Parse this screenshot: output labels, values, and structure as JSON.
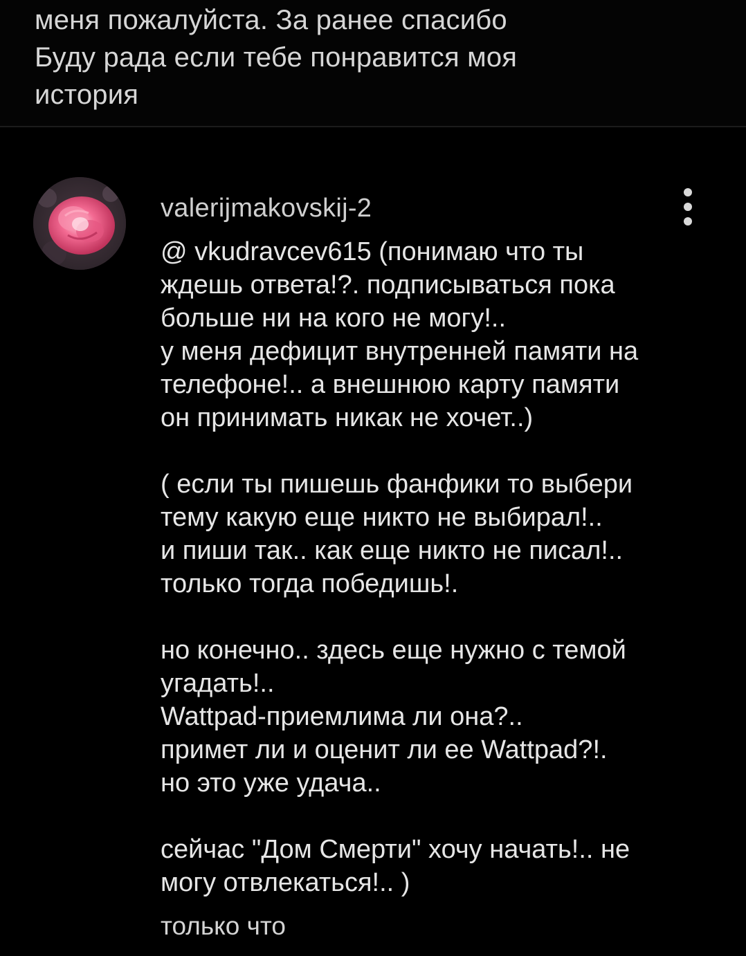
{
  "previous_comment": {
    "text": "меня пожалуйста. За ранее спасибо\nБуду рада если тебе понравится моя\nистория"
  },
  "comment": {
    "username": "valerijmakovskij-2",
    "paragraphs": [
      "@ vkudravcev615  (понимаю  что ты\nждешь ответа!?.  подписываться пока\nбольше ни на кого не могу!..\nу меня  дефицит внутренней памяти на\nтелефоне!..  а внешнюю  карту памяти\nон принимать никак не хочет..)",
      "( если ты пишешь фанфики  то выбери\nтему какую еще никто не выбирал!..\nи пиши так..  как еще никто не писал!..\nтолько тогда победишь!.",
      "но конечно.. здесь еще нужно с темой\nугадать!..\nWattpad-приемлима ли она?..\nпримет ли и оценит ли ее Wattpad?!.\nно это уже удача..",
      "сейчас  \"Дом Смерти\" хочу начать!..  не\nмогу отвлекаться!.. )"
    ],
    "timestamp": "только что",
    "avatar_icon": "rose-avatar-icon",
    "more_icon": "more-vertical-icon"
  },
  "colors": {
    "background": "#000000",
    "text": "#e6e6e6",
    "divider": "#1c1c1c"
  }
}
